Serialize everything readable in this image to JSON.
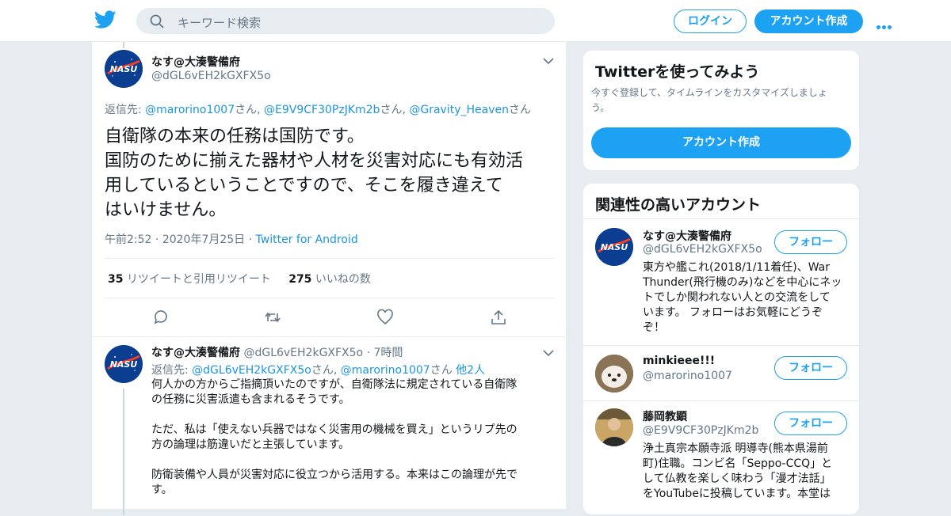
{
  "colors": {
    "accent": "#1da1f2",
    "link": "#1b95e0",
    "muted": "#657786",
    "text": "#14171a",
    "bg": "#e6ecf0"
  },
  "topbar": {
    "search_placeholder": "キーワード検索",
    "login": "ログイン",
    "signup": "アカウント作成"
  },
  "main_tweet": {
    "name": "なす@大湊警備府",
    "handle": "@dGL6vEH2kGXFX5o",
    "reply_prefix": "返信先: ",
    "reply_users": [
      "@marorino1007",
      "@E9V9CF30PzJKm2b",
      "@Gravity_Heaven"
    ],
    "san": "さん",
    "sep": ", ",
    "text_lines": [
      "自衛隊の本来の任務は国防です。",
      "国防のために揃えた器材や人材を災害対応にも有効活",
      "用しているということですので、そこを履き違えて",
      "はいけません。"
    ],
    "time": "午前2:52",
    "date": "2020年7月25日",
    "dot": " · ",
    "source": "Twitter for Android",
    "retweets": "35",
    "retweets_label": "リツイートと引用リツイート",
    "likes": "275",
    "likes_label": "いいねの数"
  },
  "reply_tweet": {
    "name": "なす@大湊警備府",
    "handle": "@dGL6vEH2kGXFX5o",
    "time": "7時間",
    "reply_prefix": "返信先: ",
    "reply_users": [
      "@dGL6vEH2kGXFX5o",
      "@marorino1007"
    ],
    "san": "さん",
    "sep": ", ",
    "others": "他2人",
    "paragraphs": [
      [
        "何人かの方からご指摘頂いたのですが、自衛隊法に規定されている自衛隊",
        "の任務に災害派遣も含まれるそうです。"
      ],
      [
        "ただ、私は「使えない兵器ではなく災害用の機械を買え」というリプ先の",
        "方の論理は筋違いだと主張しています。"
      ],
      [
        "防衛装備や人員が災害対応に役立つから活用する。本来はこの論理が先で",
        "す。"
      ]
    ]
  },
  "signup_card": {
    "title": "Twitterを使ってみよう",
    "sub": "今すぐ登録して、タイムラインをカスタマイズしましょ",
    "sub2": "う。",
    "button": "アカウント作成"
  },
  "related": {
    "title": "関連性の高いアカウント",
    "follow": "フォロー",
    "accounts": [
      {
        "name": "なす@大湊警備府",
        "handle": "@dGL6vEH2kGXFX5o",
        "bio": [
          "東方や艦これ(2018/1/11着任)、War",
          "Thunder(飛行機のみ)などを中心にネッ",
          "トでしか関われない人との交流をして",
          "います。 フォローはお気軽にどうぞ",
          "ぞ！"
        ]
      },
      {
        "name": "minkieee!!!",
        "handle": "@marorino1007",
        "bio": []
      },
      {
        "name": "藤岡教顕",
        "handle": "@E9V9CF30PzJKm2b",
        "bio": [
          "浄土真宗本願寺派 明導寺(熊本県湯前",
          "町)住職。コンビ名「Seppo-CCQ」と",
          "して仏教を楽しく味わう「漫才法話」",
          "をYouTubeに投稿しています。本堂は"
        ]
      }
    ]
  }
}
